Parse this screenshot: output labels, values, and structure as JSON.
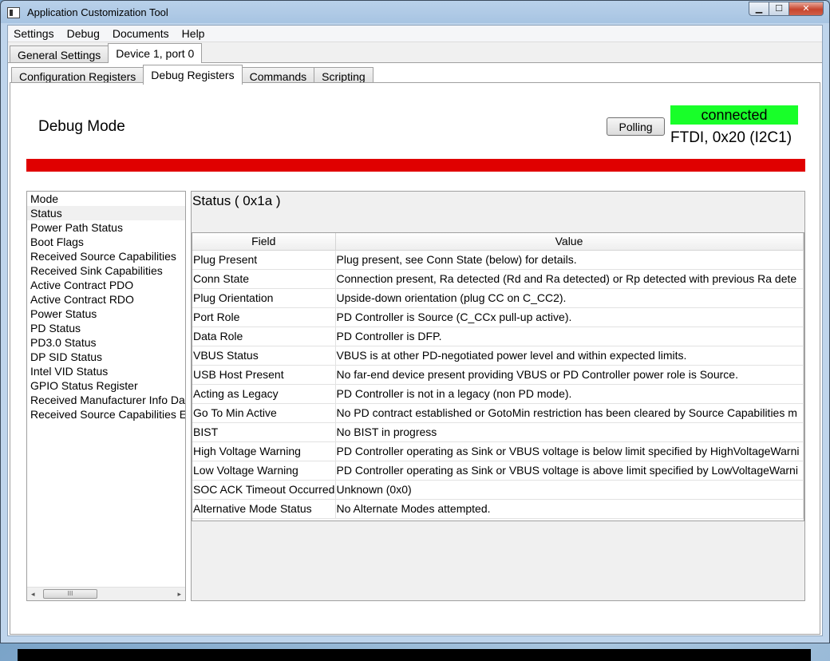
{
  "window": {
    "title": "Application Customization Tool"
  },
  "menu": [
    "Settings",
    "Debug",
    "Documents",
    "Help"
  ],
  "top_tabs": [
    {
      "label": "General Settings",
      "active": false
    },
    {
      "label": "Device 1, port 0",
      "active": true
    }
  ],
  "inner_tabs": [
    {
      "label": "Configuration Registers",
      "active": false
    },
    {
      "label": "Debug Registers",
      "active": true
    },
    {
      "label": "Commands",
      "active": false
    },
    {
      "label": "Scripting",
      "active": false
    }
  ],
  "header": {
    "mode_title": "Debug Mode",
    "polling_label": "Polling",
    "connection_status": "connected",
    "connection_info": "FTDI, 0x20 (I2C1)",
    "status_color": "#18ff29",
    "alert_bar_color": "#e00000"
  },
  "register_list": [
    "Mode",
    "Status",
    "Power Path Status",
    "Boot Flags",
    "Received Source Capabilities",
    "Received Sink Capabilities",
    "Active Contract PDO",
    "Active Contract RDO",
    "Power Status",
    "PD Status",
    "PD3.0 Status",
    "DP SID Status",
    "Intel VID Status",
    "GPIO Status Register",
    "Received Manufacturer Info Da",
    "Received Source Capabilities E"
  ],
  "selected_register": "Status",
  "detail": {
    "title": "Status  ( 0x1a )",
    "columns": [
      "Field",
      "Value"
    ],
    "rows": [
      {
        "field": "Plug Present",
        "value": "Plug present, see Conn State (below) for details."
      },
      {
        "field": "Conn State",
        "value": "Connection present, Ra detected (Rd and Ra detected) or Rp detected with previous Ra dete"
      },
      {
        "field": "Plug Orientation",
        "value": "Upside-down orientation (plug CC on C_CC2)."
      },
      {
        "field": "Port Role",
        "value": "PD Controller is Source (C_CCx pull-up active)."
      },
      {
        "field": "Data Role",
        "value": "PD Controller is DFP."
      },
      {
        "field": "VBUS Status",
        "value": "VBUS is at other PD-negotiated power level and within expected limits."
      },
      {
        "field": "USB Host Present",
        "value": "No far-end device present providing VBUS or PD Controller power role is Source."
      },
      {
        "field": "Acting as Legacy",
        "value": "PD Controller is not in a legacy (non PD mode)."
      },
      {
        "field": "Go To Min Active",
        "value": "No PD contract established or GotoMin restriction has been cleared by Source Capabilities m"
      },
      {
        "field": "BIST",
        "value": "No BIST in progress"
      },
      {
        "field": "High Voltage Warning",
        "value": "PD Controller operating as Sink or VBUS voltage is below limit specified by HighVoltageWarni"
      },
      {
        "field": "Low Voltage Warning",
        "value": "PD Controller operating as Sink or VBUS voltage is above limit specified by LowVoltageWarni"
      },
      {
        "field": "SOC ACK Timeout Occurred",
        "value": "Unknown (0x0)"
      },
      {
        "field": "Alternative Mode Status",
        "value": "No Alternate Modes attempted."
      }
    ]
  },
  "scrollbar": {
    "left_arrow": "◂",
    "right_arrow": "▸",
    "thumb_grip": "III"
  }
}
